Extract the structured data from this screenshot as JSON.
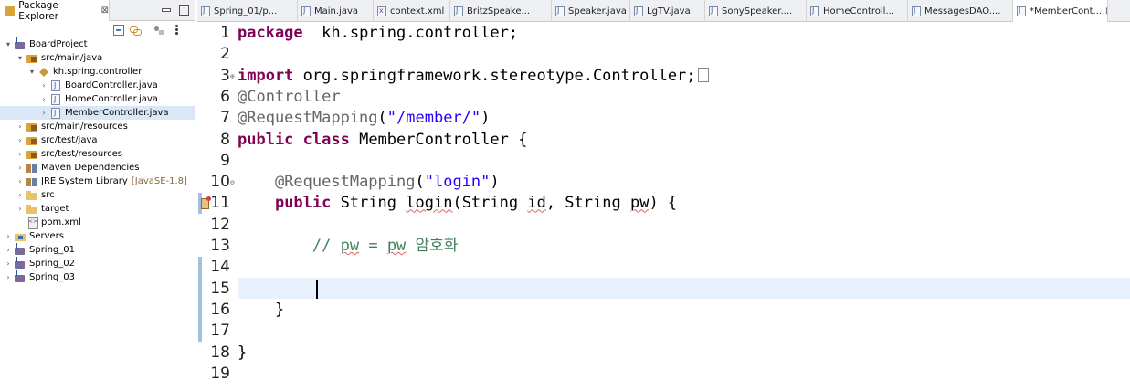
{
  "package_explorer": {
    "title": "Package Explorer",
    "close_glyph": "⊠",
    "toolbar": [
      "collapse-all-icon",
      "link-with-editor-icon",
      "focus-icon",
      "view-menu-icon"
    ],
    "tree": [
      {
        "label": "BoardProject",
        "twisty": "▾",
        "icon": "project",
        "level": 0
      },
      {
        "label": "src/main/java",
        "twisty": "▾",
        "icon": "src",
        "level": 1
      },
      {
        "label": "kh.spring.controller",
        "twisty": "▾",
        "icon": "pkg",
        "level": 2
      },
      {
        "label": "BoardController.java",
        "twisty": "›",
        "icon": "java",
        "level": 3
      },
      {
        "label": "HomeController.java",
        "twisty": "›",
        "icon": "java",
        "level": 3
      },
      {
        "label": "MemberController.java",
        "twisty": "›",
        "icon": "java",
        "level": 3,
        "selected": true
      },
      {
        "label": "src/main/resources",
        "twisty": "›",
        "icon": "src",
        "level": 1
      },
      {
        "label": "src/test/java",
        "twisty": "›",
        "icon": "src",
        "level": 1
      },
      {
        "label": "src/test/resources",
        "twisty": "›",
        "icon": "src",
        "level": 1
      },
      {
        "label": "Maven Dependencies",
        "twisty": "›",
        "icon": "lib",
        "level": 1
      },
      {
        "label": "JRE System Library",
        "suffix": "[JavaSE-1.8]",
        "twisty": "›",
        "icon": "lib",
        "level": 1
      },
      {
        "label": "src",
        "twisty": "›",
        "icon": "folder",
        "level": 1
      },
      {
        "label": "target",
        "twisty": "›",
        "icon": "folder",
        "level": 1
      },
      {
        "label": "pom.xml",
        "twisty": "",
        "icon": "xml",
        "level": 1
      },
      {
        "label": "Servers",
        "twisty": "›",
        "icon": "server",
        "level": 0
      },
      {
        "label": "Spring_01",
        "twisty": "›",
        "icon": "project",
        "level": 0
      },
      {
        "label": "Spring_02",
        "twisty": "›",
        "icon": "project",
        "level": 0
      },
      {
        "label": "Spring_03",
        "twisty": "›",
        "icon": "project",
        "level": 0
      }
    ]
  },
  "editor_tabs": [
    {
      "label": "Spring_01/p...",
      "icon": "java",
      "active": false
    },
    {
      "label": "Main.java",
      "icon": "java",
      "active": false
    },
    {
      "label": "context.xml",
      "icon": "xml",
      "active": false
    },
    {
      "label": "BritzSpeake...",
      "icon": "java",
      "active": false
    },
    {
      "label": "Speaker.java",
      "icon": "java",
      "active": false
    },
    {
      "label": "LgTV.java",
      "icon": "java",
      "active": false
    },
    {
      "label": "SonySpeaker....",
      "icon": "java",
      "active": false
    },
    {
      "label": "HomeControll...",
      "icon": "java",
      "active": false
    },
    {
      "label": "MessagesDAO....",
      "icon": "java",
      "active": false
    },
    {
      "label": "*MemberCont...",
      "icon": "java",
      "active": true,
      "close": "⊠"
    }
  ],
  "code": {
    "current_line": 14,
    "lines": [
      {
        "n": "1",
        "segs": [
          [
            "kw",
            "package"
          ],
          [
            "",
            "  kh.spring.controller;"
          ]
        ]
      },
      {
        "n": "2",
        "segs": []
      },
      {
        "n": "3",
        "fold": "⊕",
        "segs": [
          [
            "kw",
            "import"
          ],
          [
            "",
            " org.springframework.stereotype.Controller;"
          ]
        ],
        "folded": true
      },
      {
        "n": "6",
        "segs": [
          [
            "ann",
            "@Controller"
          ]
        ]
      },
      {
        "n": "7",
        "segs": [
          [
            "ann",
            "@RequestMapping"
          ],
          [
            "",
            "("
          ],
          [
            "str",
            "\"/member/\""
          ],
          [
            "",
            ")"
          ]
        ]
      },
      {
        "n": "8",
        "segs": [
          [
            "kw",
            "public"
          ],
          [
            "",
            " "
          ],
          [
            "kw",
            "class"
          ],
          [
            "",
            " MemberController {"
          ]
        ]
      },
      {
        "n": "9",
        "segs": []
      },
      {
        "n": "10",
        "fold": "⊖",
        "segs": [
          [
            "",
            "    "
          ],
          [
            "ann",
            "@RequestMapping"
          ],
          [
            "",
            "("
          ],
          [
            "str",
            "\"login\""
          ],
          [
            "",
            ")"
          ]
        ]
      },
      {
        "n": "11",
        "marker": true,
        "segs": [
          [
            "",
            "    "
          ],
          [
            "kw",
            "public"
          ],
          [
            "",
            " String "
          ],
          [
            "sq",
            "login"
          ],
          [
            "",
            "(String "
          ],
          [
            "sq",
            "id"
          ],
          [
            "",
            ", String "
          ],
          [
            "sq",
            "pw"
          ],
          [
            "",
            ") {"
          ]
        ]
      },
      {
        "n": "12",
        "segs": []
      },
      {
        "n": "13",
        "segs": [
          [
            "",
            "        "
          ],
          [
            "cmt",
            "// "
          ],
          [
            "cmtsq",
            "pw"
          ],
          [
            "cmt",
            " = "
          ],
          [
            "cmtsq",
            "pw"
          ],
          [
            "cmt",
            " 암호화"
          ]
        ]
      },
      {
        "n": "14",
        "segs": []
      },
      {
        "n": "15",
        "segs": []
      },
      {
        "n": "16",
        "segs": [
          [
            "",
            "    }"
          ]
        ]
      },
      {
        "n": "17",
        "segs": []
      },
      {
        "n": "18",
        "segs": [
          [
            "",
            "}"
          ]
        ]
      },
      {
        "n": "19",
        "segs": []
      }
    ]
  }
}
